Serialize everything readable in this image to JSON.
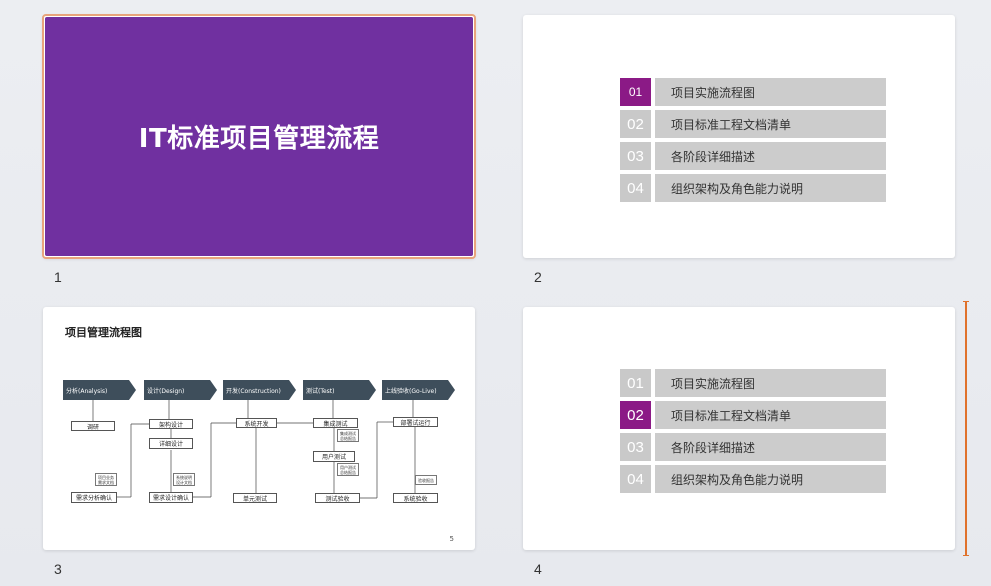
{
  "slides": [
    {
      "number": "1",
      "title": "IT标准项目管理流程"
    },
    {
      "number": "2",
      "toc": [
        {
          "num": "01",
          "label": "项目实施流程图",
          "active": true
        },
        {
          "num": "02",
          "label": "项目标准工程文档清单",
          "active": false
        },
        {
          "num": "03",
          "label": "各阶段详细描述",
          "active": false
        },
        {
          "num": "04",
          "label": "组织架构及角色能力说明",
          "active": false
        }
      ]
    },
    {
      "number": "3",
      "title": "项目管理流程图",
      "page_number": "5",
      "phases": [
        "分析(Analysis)",
        "设计(Design)",
        "开发(Construction)",
        "测试(Test)",
        "上线验收(Go-Live)"
      ],
      "boxes": {
        "research": "调研",
        "req_confirm": "需求分析确认",
        "arch_design": "架构设计",
        "detail_design": "详细设计",
        "design_confirm": "需求设计确认",
        "sys_dev": "系统开发",
        "unit_test": "单元测试",
        "integration_test": "集成测试",
        "user_test": "用户测试",
        "test_accept": "测试验收",
        "deploy": "部署试运行",
        "sys_accept": "系统验收"
      },
      "notes": {
        "req_doc": [
          "项目业务",
          "需求文档"
        ],
        "design_doc": [
          "系统说明",
          "设计文档"
        ],
        "int_report": [
          "集成测试",
          "总结报告"
        ],
        "user_report": [
          "用户测试",
          "总结报告"
        ],
        "go_live_report": [
          "验收报告"
        ]
      }
    },
    {
      "number": "4",
      "toc": [
        {
          "num": "01",
          "label": "项目实施流程图",
          "active": false
        },
        {
          "num": "02",
          "label": "项目标准工程文档清单",
          "active": true
        },
        {
          "num": "03",
          "label": "各阶段详细描述",
          "active": false
        },
        {
          "num": "04",
          "label": "组织架构及角色能力说明",
          "active": false
        }
      ]
    }
  ],
  "colors": {
    "title_bg": "#7030a0",
    "toc_active": "#8b1a86",
    "toc_inactive": "#c9c9c9",
    "selection": "#e8a47c",
    "scrollbar": "#e0722c"
  }
}
